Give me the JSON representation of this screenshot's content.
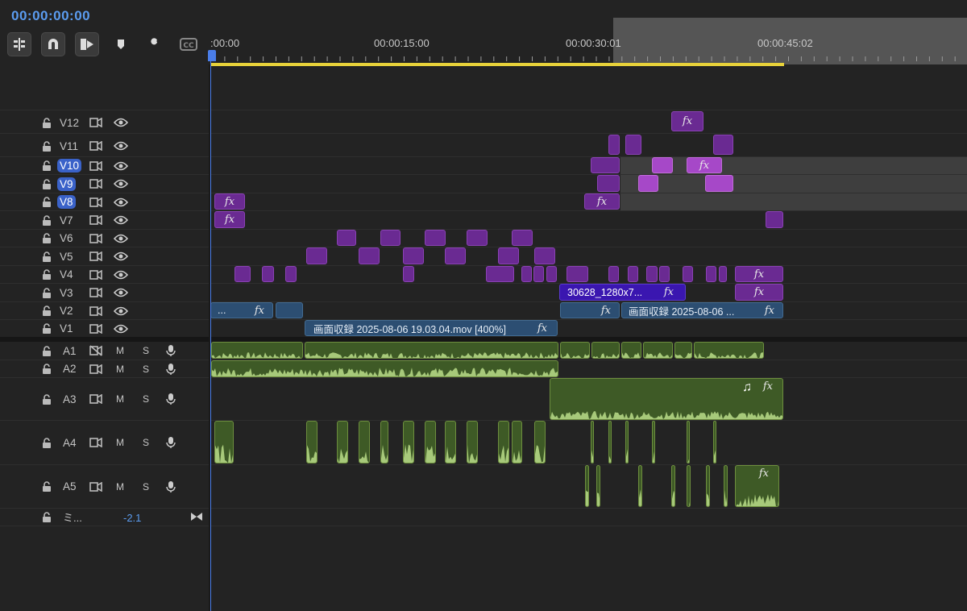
{
  "timecode": "00:00:00:00",
  "toolbar": [
    {
      "name": "insert-tracks-icon"
    },
    {
      "name": "snap-magnet-icon"
    },
    {
      "name": "linked-selection-icon"
    },
    {
      "name": "add-marker-icon"
    },
    {
      "name": "wrench-settings-icon"
    },
    {
      "name": "captions-cc-icon",
      "label": "CC"
    }
  ],
  "ruler": {
    "labels": [
      ":00:00",
      "00:00:15:00",
      "00:00:30:01",
      "00:00:45:02"
    ]
  },
  "video_tracks": [
    {
      "name": "V12",
      "selected": false
    },
    {
      "name": "V11",
      "selected": false
    },
    {
      "name": "V10",
      "selected": true
    },
    {
      "name": "V9",
      "selected": true
    },
    {
      "name": "V8",
      "selected": true
    },
    {
      "name": "V7",
      "selected": false
    },
    {
      "name": "V6",
      "selected": false
    },
    {
      "name": "V5",
      "selected": false
    },
    {
      "name": "V4",
      "selected": false
    },
    {
      "name": "V3",
      "selected": false
    },
    {
      "name": "V2",
      "selected": false
    },
    {
      "name": "V1",
      "selected": false
    }
  ],
  "audio_tracks": [
    {
      "name": "A1",
      "mute": "M",
      "solo": "S"
    },
    {
      "name": "A2",
      "mute": "M",
      "solo": "S"
    },
    {
      "name": "A3",
      "mute": "M",
      "solo": "S"
    },
    {
      "name": "A4",
      "mute": "M",
      "solo": "S"
    },
    {
      "name": "A5",
      "mute": "M",
      "solo": "S"
    }
  ],
  "master": {
    "name": "ミ...",
    "value": "-2.1"
  },
  "clip_labels": {
    "v1_main": "画面収録 2025-08-06 19.03.04.mov [400%]",
    "v2_right": "画面収録 2025-08-06 ...",
    "v2_left": "...",
    "v3_blue": "30628_1280x7...",
    "fx": "fx",
    "music": "♫"
  },
  "colors": {
    "accent_blue": "#5b9cf0",
    "playhead": "#4a7de8",
    "work_area": "#e8d23a",
    "video_purple": "#6a2a92",
    "video_blue": "#2c4e72",
    "audio_green": "#3e5a26"
  }
}
